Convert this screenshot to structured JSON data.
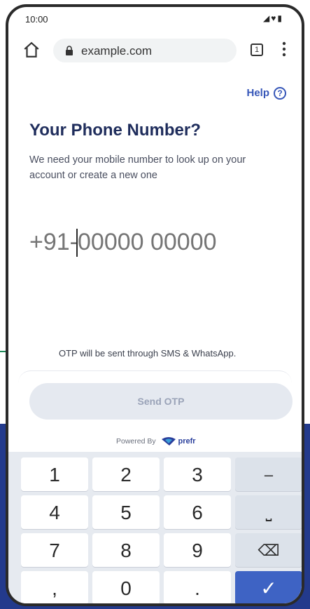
{
  "status_bar": {
    "time": "10:00",
    "icons": "◢♥▮"
  },
  "browser": {
    "url": "example.com",
    "tabs_count": "1"
  },
  "help": {
    "label": "Help",
    "icon_glyph": "?"
  },
  "page": {
    "title": "Your Phone Number?",
    "subtitle": "We need your mobile number to look up on your account or create a new one"
  },
  "phone_input": {
    "placeholder": "+91-00000 00000"
  },
  "otp_note": "OTP will be sent through SMS & WhatsApp.",
  "send_button": {
    "label": "Send OTP"
  },
  "powered_by": {
    "label": "Powered By",
    "brand": "prefr"
  },
  "keypad": {
    "rows": [
      [
        "1",
        "2",
        "3",
        "–"
      ],
      [
        "4",
        "5",
        "6",
        "⎵"
      ],
      [
        "7",
        "8",
        "9",
        "⌫"
      ],
      [
        ",",
        "0",
        ".",
        "✓"
      ]
    ]
  },
  "colors": {
    "accent": "#3656b8",
    "brand_navy": "#233a8c",
    "success_dot": "#4d9a66"
  }
}
